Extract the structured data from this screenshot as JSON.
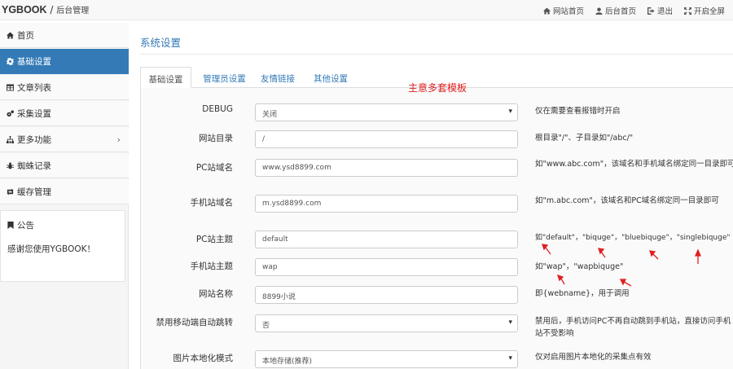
{
  "header": {
    "brand": "YGBOOK",
    "separator": "/",
    "subtitle": "后台管理",
    "nav": [
      {
        "label": "网站首页",
        "icon": "home-icon"
      },
      {
        "label": "后台首页",
        "icon": "user-icon"
      },
      {
        "label": "退出",
        "icon": "logout-icon"
      },
      {
        "label": "开启全屏",
        "icon": "fullscreen-icon"
      }
    ]
  },
  "sidebar": {
    "items": [
      {
        "label": "首页",
        "icon": "home-icon"
      },
      {
        "label": "基础设置",
        "icon": "gear-icon",
        "active": true
      },
      {
        "label": "文章列表",
        "icon": "table-icon"
      },
      {
        "label": "采集设置",
        "icon": "gears-icon"
      },
      {
        "label": "更多功能",
        "icon": "sitemap-icon",
        "chevron": "›"
      },
      {
        "label": "蜘蛛记录",
        "icon": "bug-icon"
      },
      {
        "label": "缓存管理",
        "icon": "refresh-icon"
      }
    ],
    "notice": {
      "title": "公告",
      "text": "感谢您使用YGBOOK！"
    }
  },
  "main": {
    "title": "系统设置",
    "tabs": [
      "基础设置",
      "管理员设置",
      "友情链接",
      "其他设置"
    ],
    "active_tab": 0,
    "annotation": "主意多套模板",
    "annotation_color": "#e02020",
    "accent_color": "#337ab7",
    "rows": [
      {
        "label": "DEBUG",
        "type": "select",
        "value": "关闭",
        "hint": "仅在需要查看报错时开启"
      },
      {
        "label": "网站目录",
        "type": "input",
        "value": "/",
        "hint": "根目录\"/\"、子目录如\"/abc/\""
      },
      {
        "label": "PC站域名",
        "type": "input",
        "value": "www.ysd8899.com",
        "hint": "如\"www.abc.com\"，该域名和手机域名绑定同一目录即可"
      },
      {
        "label": "手机站域名",
        "type": "input",
        "value": "m.ysd8899.com",
        "hint": "如\"m.abc.com\"，该域名和PC域名绑定同一目录即可"
      },
      {
        "label": "PC站主题",
        "type": "input",
        "value": "default",
        "hint": "如\"default\"，\"biquge\"，\"bluebiquge\"，\"singlebiquge\""
      },
      {
        "label": "手机站主题",
        "type": "input",
        "value": "wap",
        "hint": "如\"wap\"，\"wapbiquge\""
      },
      {
        "label": "网站名称",
        "type": "input",
        "value": "8899小说",
        "hint": "即{webname}，用于调用"
      },
      {
        "label": "禁用移动端自动跳转",
        "type": "select",
        "value": "否",
        "hint": "禁用后，手机访问PC不再自动跳到手机站，直接访问手机站不受影响"
      },
      {
        "label": "图片本地化模式",
        "type": "select",
        "value": "本地存储(推荐)",
        "hint": "仅对启用图片本地化的采集点有效"
      }
    ]
  }
}
